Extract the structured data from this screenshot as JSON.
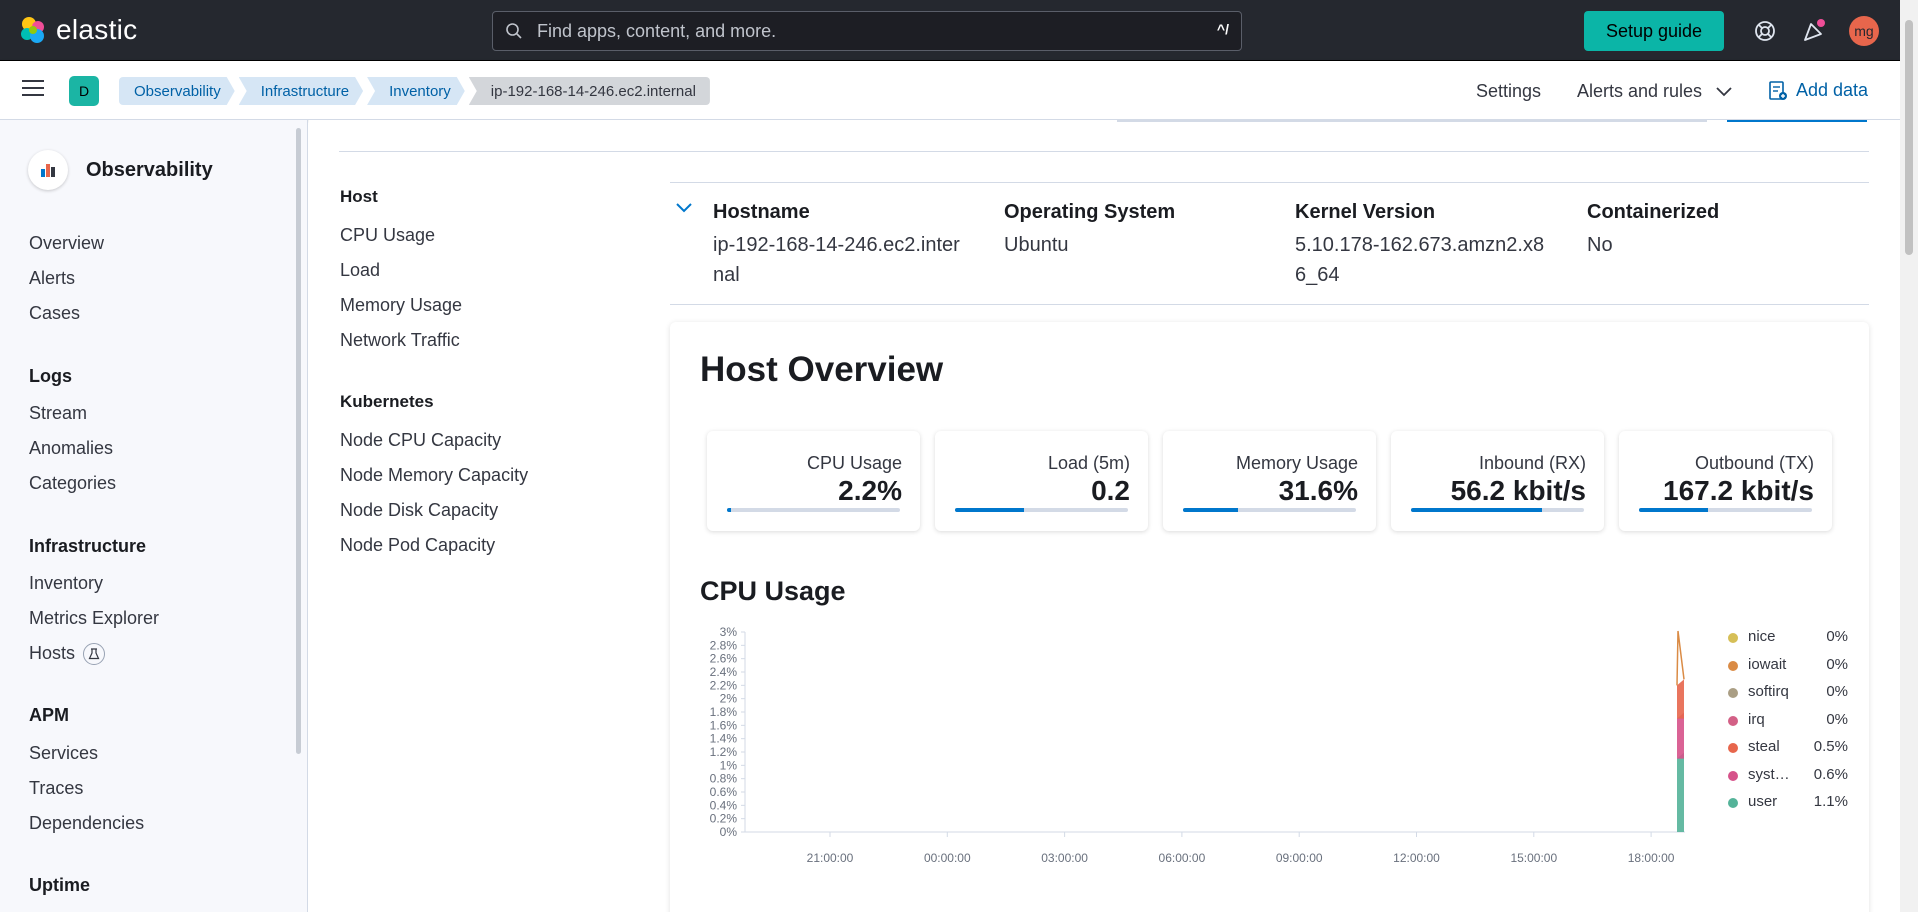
{
  "header": {
    "brand": "elastic",
    "search_placeholder": "Find apps, content, and more.",
    "search_shortcut": "^/",
    "setup_guide": "Setup guide",
    "avatar_initials": "mg"
  },
  "subheader": {
    "space_letter": "D",
    "breadcrumbs": [
      "Observability",
      "Infrastructure",
      "Inventory",
      "ip-192-168-14-246.ec2.internal"
    ],
    "settings": "Settings",
    "alerts_rules": "Alerts and rules",
    "add_data": "Add data"
  },
  "sidebar": {
    "title": "Observability",
    "items": [
      "Overview",
      "Alerts",
      "Cases"
    ],
    "sections": [
      {
        "title": "Logs",
        "items": [
          "Stream",
          "Anomalies",
          "Categories"
        ]
      },
      {
        "title": "Infrastructure",
        "items": [
          "Inventory",
          "Metrics Explorer",
          "Hosts"
        ]
      },
      {
        "title": "APM",
        "items": [
          "Services",
          "Traces",
          "Dependencies"
        ]
      },
      {
        "title": "Uptime",
        "items": []
      }
    ]
  },
  "toc": {
    "host_title": "Host",
    "host_items": [
      "CPU Usage",
      "Load",
      "Memory Usage",
      "Network Traffic"
    ],
    "k8s_title": "Kubernetes",
    "k8s_items": [
      "Node CPU Capacity",
      "Node Memory Capacity",
      "Node Disk Capacity",
      "Node Pod Capacity"
    ]
  },
  "metadata": [
    {
      "key": "Hostname",
      "value": "ip-192-168-14-246.ec2.internal"
    },
    {
      "key": "Operating System",
      "value": "Ubuntu"
    },
    {
      "key": "Kernel Version",
      "value": "5.10.178-162.673.amzn2.x86_64"
    },
    {
      "key": "Containerized",
      "value": "No"
    }
  ],
  "overview": {
    "title": "Host Overview",
    "kpis": [
      {
        "label": "CPU Usage",
        "value": "2.2%",
        "fraction": 0.022
      },
      {
        "label": "Load (5m)",
        "value": "0.2",
        "fraction": 0.4
      },
      {
        "label": "Memory Usage",
        "value": "31.6%",
        "fraction": 0.316
      },
      {
        "label": "Inbound (RX)",
        "value": "56.2 kbit/s",
        "fraction": 0.76
      },
      {
        "label": "Outbound (TX)",
        "value": "167.2 kbit/s",
        "fraction": 0.4
      }
    ]
  },
  "cpu_section_title": "CPU Usage",
  "chart_data": {
    "type": "area",
    "title": "CPU Usage",
    "x_ticks": [
      "21:00:00",
      "00:00:00",
      "03:00:00",
      "06:00:00",
      "09:00:00",
      "12:00:00",
      "15:00:00",
      "18:00:00"
    ],
    "y_ticks": [
      "3%",
      "2.8%",
      "2.6%",
      "2.4%",
      "2.2%",
      "2%",
      "1.8%",
      "1.6%",
      "1.4%",
      "1.2%",
      "1%",
      "0.8%",
      "0.6%",
      "0.4%",
      "0.2%",
      "0%"
    ],
    "ylim": [
      0,
      3
    ],
    "stacked": true,
    "series": [
      {
        "name": "nice",
        "last": "0%",
        "color": "#d6bf57"
      },
      {
        "name": "iowait",
        "last": "0%",
        "color": "#da8b45"
      },
      {
        "name": "softirq",
        "last": "0%",
        "color": "#aa9e84"
      },
      {
        "name": "irq",
        "last": "0%",
        "color": "#d36086"
      },
      {
        "name": "steal",
        "last": "0.5%",
        "color": "#e7664c"
      },
      {
        "name": "syst…",
        "last": "0.6%",
        "color": "#d6528a"
      },
      {
        "name": "user",
        "last": "1.1%",
        "color": "#54b399"
      }
    ]
  }
}
